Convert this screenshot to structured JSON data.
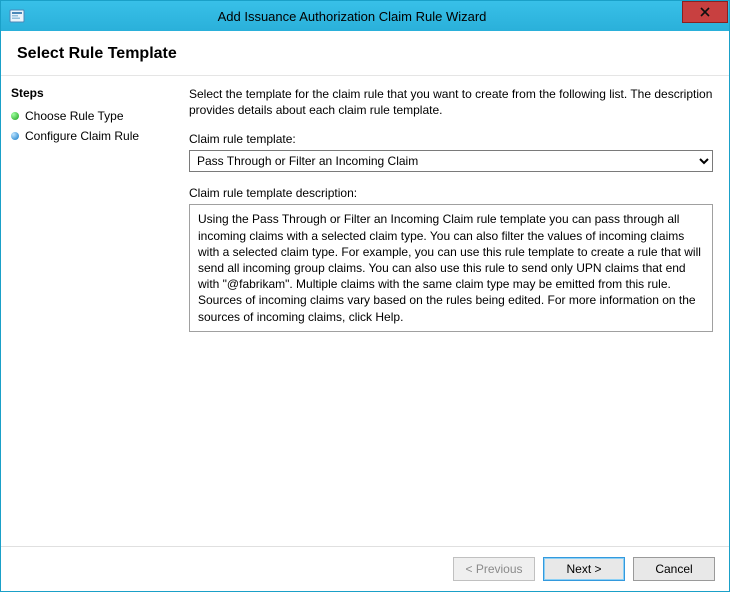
{
  "window": {
    "title": "Add Issuance Authorization Claim Rule Wizard"
  },
  "header": {
    "title": "Select Rule Template"
  },
  "sidebar": {
    "steps_title": "Steps",
    "items": [
      {
        "label": "Choose Rule Type",
        "state": "current"
      },
      {
        "label": "Configure Claim Rule",
        "state": "pending"
      }
    ]
  },
  "main": {
    "intro": "Select the template for the claim rule that you want to create from the following list. The description provides details about each claim rule template.",
    "template_label": "Claim rule template:",
    "template_selected": "Pass Through or Filter an Incoming Claim",
    "description_label": "Claim rule template description:",
    "description_text": "Using the Pass Through or Filter an Incoming Claim rule template you can pass through all incoming claims with a selected claim type.  You can also filter the values of incoming claims with a selected claim type.  For example, you can use this rule template to create a rule that will send all incoming group claims.  You can also use this rule to send only UPN claims that end with \"@fabrikam\".  Multiple claims with the same claim type may be emitted from this rule.  Sources of incoming claims vary based on the rules being edited.  For more information on the sources of incoming claims, click Help."
  },
  "footer": {
    "previous": "< Previous",
    "next": "Next >",
    "cancel": "Cancel"
  }
}
